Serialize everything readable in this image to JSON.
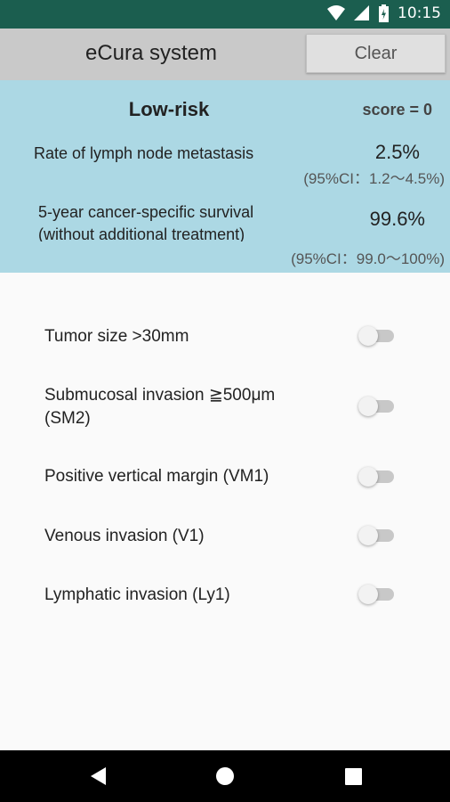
{
  "status_bar": {
    "time": "10:15"
  },
  "app_bar": {
    "title": "eCura system",
    "clear_label": "Clear"
  },
  "result": {
    "risk_level": "Low-risk",
    "score": "score = 0",
    "metastasis_label": "Rate of lymph node metastasis",
    "metastasis_value": "2.5%",
    "metastasis_ci": "(95%CI：1.2〜4.5%)",
    "survival_label_line1": "5-year cancer-specific survival",
    "survival_label_line2": "(without additional treatment)",
    "survival_value": "99.6%",
    "survival_ci": "(95%CI：99.0〜100%)",
    "background_color": "#acd8e4"
  },
  "factors": [
    {
      "label": "Tumor size >30mm",
      "checked": false
    },
    {
      "label": "Submucosal invasion ≧500μm",
      "label_line2": "(SM2)",
      "checked": false
    },
    {
      "label": "Positive vertical margin (VM1)",
      "checked": false
    },
    {
      "label": "Venous invasion (V1)",
      "checked": false
    },
    {
      "label": "Lymphatic invasion (Ly1)",
      "checked": false
    }
  ],
  "nav_bar": {
    "back": "back-icon",
    "home": "home-icon",
    "recents": "recents-icon"
  }
}
